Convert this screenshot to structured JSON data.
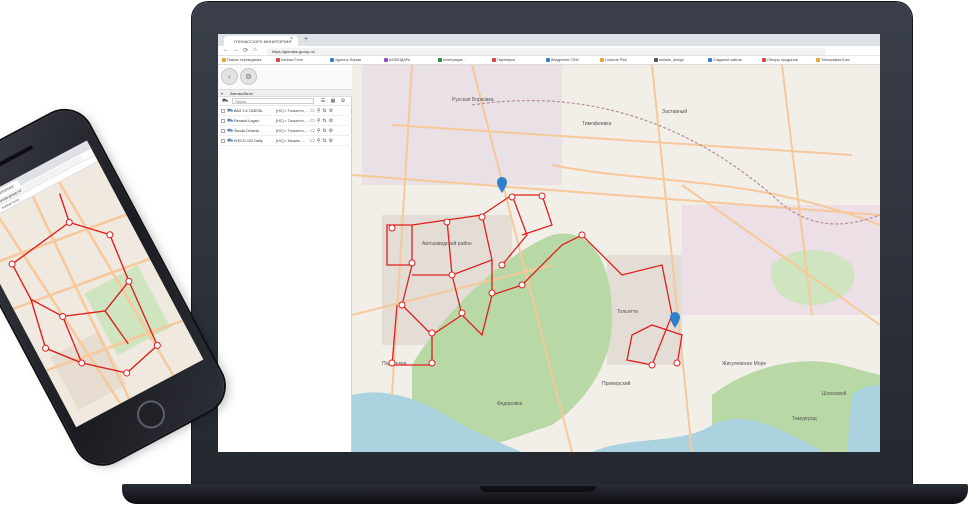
{
  "browser": {
    "tab_title": "ГЛОНАСС/GPS МОНИТОРИНГ",
    "tab_close": "×",
    "new_tab": "+",
    "url": "https://glonass-group.ru/",
    "nav": {
      "back": "←",
      "forward": "→",
      "reload": "⟳",
      "home": "⌂"
    },
    "bookmarks": [
      {
        "label": "Плагин переводчика",
        "color": "#e8a33c"
      },
      {
        "label": "Kanban Form",
        "color": "#d94343"
      },
      {
        "label": "Удалить Форма",
        "color": "#3a7bd5"
      },
      {
        "label": "КАЛЕНДАРЬ",
        "color": "#8a4fbf"
      },
      {
        "label": "Интеграция...",
        "color": "#2b8a3e"
      },
      {
        "label": "Партнерка",
        "color": "#d94343"
      },
      {
        "label": "Внедрение CRM",
        "color": "#3a7bd5"
      },
      {
        "label": "Lorsecle Pilot",
        "color": "#e8a33c"
      },
      {
        "label": "website_design",
        "color": "#555555"
      },
      {
        "label": "Создание сайтов",
        "color": "#3a7bd5"
      },
      {
        "label": "Обзоры продуктов",
        "color": "#d94343"
      },
      {
        "label": "Типография Блог",
        "color": "#e8a33c"
      }
    ]
  },
  "panel": {
    "title": "Автомобили",
    "search_placeholder": "Поиск",
    "vehicles": [
      {
        "name": "ВАЗ 1.6 ГАЗЕЛЬ",
        "location": "[HC] г. Тольятти, ..."
      },
      {
        "name": "Renault Logan",
        "location": "[HC] г. Тольятти, ..."
      },
      {
        "name": "Skoda Octavia",
        "location": "[HC] г. Тольятти, ..."
      },
      {
        "name": "IVECO 120 Daily",
        "location": "[HC] г. Казань, ..."
      }
    ]
  },
  "map": {
    "labels": [
      "Русская Борковка",
      "Тимофеевка",
      "Автозаводский район",
      "Заставный",
      "Тольятти",
      "Приморский",
      "Жигулевское Море",
      "Федоровка",
      "Тимурград",
      "Подстепки",
      "Шлюзовой"
    ],
    "route_color": "#e02020",
    "water_color": "#aad3df",
    "forest_color": "#b8d9a5",
    "marker_color": "#2f80c9"
  },
  "phone": {
    "tab_title": "ГЛОНАСС/GPS МОНИТОРИНГ",
    "url": "https://glonass-group.ru/",
    "bookmarks": "Плагин переводчика · Kanban Form"
  }
}
